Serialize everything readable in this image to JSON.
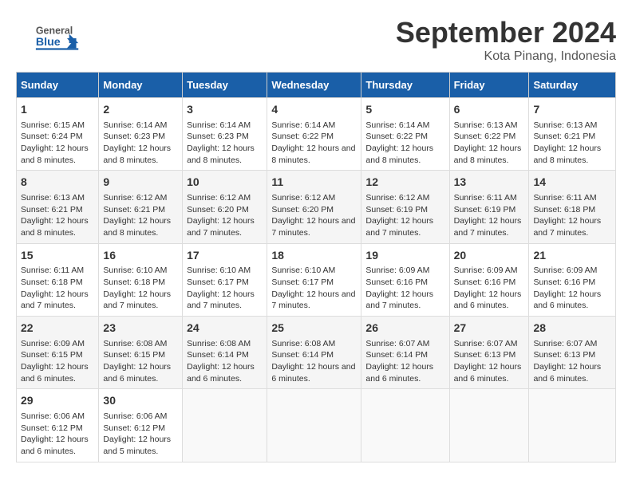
{
  "header": {
    "logo_general": "General",
    "logo_blue": "Blue",
    "title": "September 2024",
    "subtitle": "Kota Pinang, Indonesia"
  },
  "columns": [
    "Sunday",
    "Monday",
    "Tuesday",
    "Wednesday",
    "Thursday",
    "Friday",
    "Saturday"
  ],
  "weeks": [
    [
      {
        "day": "1",
        "sunrise": "Sunrise: 6:15 AM",
        "sunset": "Sunset: 6:24 PM",
        "daylight": "Daylight: 12 hours and 8 minutes."
      },
      {
        "day": "2",
        "sunrise": "Sunrise: 6:14 AM",
        "sunset": "Sunset: 6:23 PM",
        "daylight": "Daylight: 12 hours and 8 minutes."
      },
      {
        "day": "3",
        "sunrise": "Sunrise: 6:14 AM",
        "sunset": "Sunset: 6:23 PM",
        "daylight": "Daylight: 12 hours and 8 minutes."
      },
      {
        "day": "4",
        "sunrise": "Sunrise: 6:14 AM",
        "sunset": "Sunset: 6:22 PM",
        "daylight": "Daylight: 12 hours and 8 minutes."
      },
      {
        "day": "5",
        "sunrise": "Sunrise: 6:14 AM",
        "sunset": "Sunset: 6:22 PM",
        "daylight": "Daylight: 12 hours and 8 minutes."
      },
      {
        "day": "6",
        "sunrise": "Sunrise: 6:13 AM",
        "sunset": "Sunset: 6:22 PM",
        "daylight": "Daylight: 12 hours and 8 minutes."
      },
      {
        "day": "7",
        "sunrise": "Sunrise: 6:13 AM",
        "sunset": "Sunset: 6:21 PM",
        "daylight": "Daylight: 12 hours and 8 minutes."
      }
    ],
    [
      {
        "day": "8",
        "sunrise": "Sunrise: 6:13 AM",
        "sunset": "Sunset: 6:21 PM",
        "daylight": "Daylight: 12 hours and 8 minutes."
      },
      {
        "day": "9",
        "sunrise": "Sunrise: 6:12 AM",
        "sunset": "Sunset: 6:21 PM",
        "daylight": "Daylight: 12 hours and 8 minutes."
      },
      {
        "day": "10",
        "sunrise": "Sunrise: 6:12 AM",
        "sunset": "Sunset: 6:20 PM",
        "daylight": "Daylight: 12 hours and 7 minutes."
      },
      {
        "day": "11",
        "sunrise": "Sunrise: 6:12 AM",
        "sunset": "Sunset: 6:20 PM",
        "daylight": "Daylight: 12 hours and 7 minutes."
      },
      {
        "day": "12",
        "sunrise": "Sunrise: 6:12 AM",
        "sunset": "Sunset: 6:19 PM",
        "daylight": "Daylight: 12 hours and 7 minutes."
      },
      {
        "day": "13",
        "sunrise": "Sunrise: 6:11 AM",
        "sunset": "Sunset: 6:19 PM",
        "daylight": "Daylight: 12 hours and 7 minutes."
      },
      {
        "day": "14",
        "sunrise": "Sunrise: 6:11 AM",
        "sunset": "Sunset: 6:18 PM",
        "daylight": "Daylight: 12 hours and 7 minutes."
      }
    ],
    [
      {
        "day": "15",
        "sunrise": "Sunrise: 6:11 AM",
        "sunset": "Sunset: 6:18 PM",
        "daylight": "Daylight: 12 hours and 7 minutes."
      },
      {
        "day": "16",
        "sunrise": "Sunrise: 6:10 AM",
        "sunset": "Sunset: 6:18 PM",
        "daylight": "Daylight: 12 hours and 7 minutes."
      },
      {
        "day": "17",
        "sunrise": "Sunrise: 6:10 AM",
        "sunset": "Sunset: 6:17 PM",
        "daylight": "Daylight: 12 hours and 7 minutes."
      },
      {
        "day": "18",
        "sunrise": "Sunrise: 6:10 AM",
        "sunset": "Sunset: 6:17 PM",
        "daylight": "Daylight: 12 hours and 7 minutes."
      },
      {
        "day": "19",
        "sunrise": "Sunrise: 6:09 AM",
        "sunset": "Sunset: 6:16 PM",
        "daylight": "Daylight: 12 hours and 7 minutes."
      },
      {
        "day": "20",
        "sunrise": "Sunrise: 6:09 AM",
        "sunset": "Sunset: 6:16 PM",
        "daylight": "Daylight: 12 hours and 6 minutes."
      },
      {
        "day": "21",
        "sunrise": "Sunrise: 6:09 AM",
        "sunset": "Sunset: 6:16 PM",
        "daylight": "Daylight: 12 hours and 6 minutes."
      }
    ],
    [
      {
        "day": "22",
        "sunrise": "Sunrise: 6:09 AM",
        "sunset": "Sunset: 6:15 PM",
        "daylight": "Daylight: 12 hours and 6 minutes."
      },
      {
        "day": "23",
        "sunrise": "Sunrise: 6:08 AM",
        "sunset": "Sunset: 6:15 PM",
        "daylight": "Daylight: 12 hours and 6 minutes."
      },
      {
        "day": "24",
        "sunrise": "Sunrise: 6:08 AM",
        "sunset": "Sunset: 6:14 PM",
        "daylight": "Daylight: 12 hours and 6 minutes."
      },
      {
        "day": "25",
        "sunrise": "Sunrise: 6:08 AM",
        "sunset": "Sunset: 6:14 PM",
        "daylight": "Daylight: 12 hours and 6 minutes."
      },
      {
        "day": "26",
        "sunrise": "Sunrise: 6:07 AM",
        "sunset": "Sunset: 6:14 PM",
        "daylight": "Daylight: 12 hours and 6 minutes."
      },
      {
        "day": "27",
        "sunrise": "Sunrise: 6:07 AM",
        "sunset": "Sunset: 6:13 PM",
        "daylight": "Daylight: 12 hours and 6 minutes."
      },
      {
        "day": "28",
        "sunrise": "Sunrise: 6:07 AM",
        "sunset": "Sunset: 6:13 PM",
        "daylight": "Daylight: 12 hours and 6 minutes."
      }
    ],
    [
      {
        "day": "29",
        "sunrise": "Sunrise: 6:06 AM",
        "sunset": "Sunset: 6:12 PM",
        "daylight": "Daylight: 12 hours and 6 minutes."
      },
      {
        "day": "30",
        "sunrise": "Sunrise: 6:06 AM",
        "sunset": "Sunset: 6:12 PM",
        "daylight": "Daylight: 12 hours and 5 minutes."
      },
      null,
      null,
      null,
      null,
      null
    ]
  ]
}
